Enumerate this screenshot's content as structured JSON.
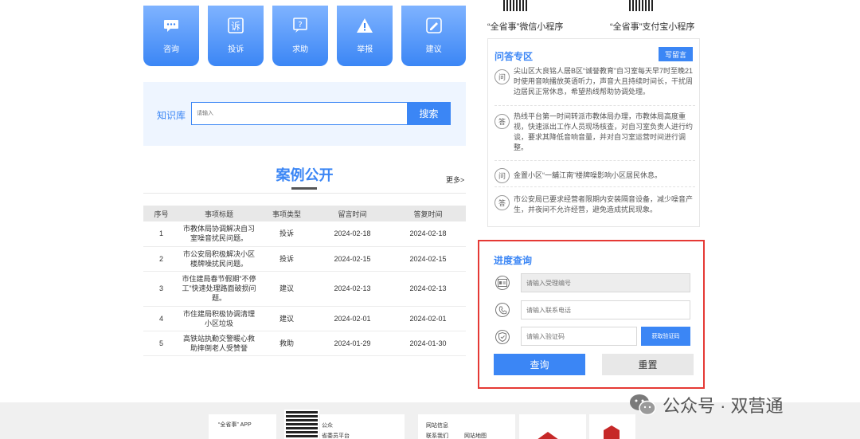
{
  "tiles": [
    {
      "label": "咨询",
      "icon": "chat-bubble-icon"
    },
    {
      "label": "投诉",
      "icon": "complaint-icon"
    },
    {
      "label": "求助",
      "icon": "help-icon"
    },
    {
      "label": "举报",
      "icon": "warning-icon"
    },
    {
      "label": "建议",
      "icon": "suggestion-icon"
    }
  ],
  "knowledge": {
    "label": "知识库",
    "placeholder": "请输入",
    "search_label": "搜索"
  },
  "cases": {
    "title": "案例公开",
    "more": "更多>",
    "headers": [
      "序号",
      "事项标题",
      "事项类型",
      "留言时间",
      "答复时间"
    ],
    "rows": [
      {
        "no": "1",
        "title": "市教体局协调解决自习室噪音扰民问题。",
        "type": "投诉",
        "created": "2024-02-18",
        "replied": "2024-02-18"
      },
      {
        "no": "2",
        "title": "市公安局积极解决小区楼牌噪扰民问题。",
        "type": "投诉",
        "created": "2024-02-15",
        "replied": "2024-02-15"
      },
      {
        "no": "3",
        "title": "市住建局春节假期“不停工”快速处理路面破损问题。",
        "type": "建议",
        "created": "2024-02-13",
        "replied": "2024-02-13"
      },
      {
        "no": "4",
        "title": "市住建局积极协调清理小区垃圾",
        "type": "建议",
        "created": "2024-02-01",
        "replied": "2024-02-01"
      },
      {
        "no": "5",
        "title": "高铁站执勤交警暖心救助摔倒老人受赞誉",
        "type": "救助",
        "created": "2024-01-29",
        "replied": "2024-01-30"
      }
    ]
  },
  "mini_programs": {
    "wechat": "“全省事”微信小程序",
    "alipay": "“全省事”支付宝小程序"
  },
  "qa": {
    "title": "问答专区",
    "button": "写留言",
    "items": [
      {
        "badge": "问",
        "text": "尖山区大良铭人居B区“诚誉教育”自习室每天早7时至晚21时使用音响播放英语听力，声音大且持续时间长，干扰周边居民正常休息，希望热线帮助协调处理。"
      },
      {
        "badge": "答",
        "text": "热线平台第一时间转派市教体局办理，市教体局高度重视，快速派出工作人员现场核查，对自习室负责人进行约谈，要求其降低音响音量，并对自习室运营时间进行调整。"
      },
      {
        "badge": "问",
        "text": "金置小区“一舖江南”楼牌噪影响小区居民休息。"
      },
      {
        "badge": "答",
        "text": "市公安局已要求经营者限期内安装隔音设备，减少噪音产生，并夜间不允许经营，避免造成扰民现象。"
      }
    ]
  },
  "progress": {
    "title": "进度查询",
    "id_placeholder": "请输入受理编号",
    "phone_placeholder": "请输入联系电话",
    "code_placeholder": "请输入验证码",
    "code_button": "获取验证码",
    "query_label": "查询",
    "reset_label": "重置"
  },
  "footer": {
    "app_label": "“全省事” APP",
    "box2_line1": "公众",
    "box2_line2": "省委员平台",
    "box3_title": "网站信息",
    "box3_a": "联系我们",
    "box3_b": "网站地图"
  },
  "watermark": {
    "text": "公众号 · 双营通"
  },
  "colors": {
    "primary": "#3b86f5",
    "highlight_border": "#e53935"
  }
}
